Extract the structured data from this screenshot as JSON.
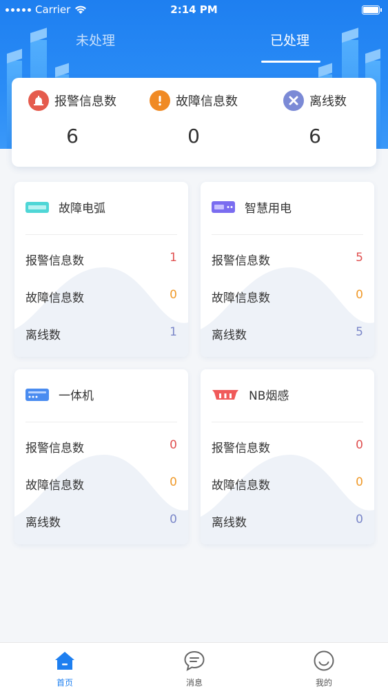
{
  "status_bar": {
    "carrier": "Carrier",
    "time": "2:14 PM"
  },
  "tabs": [
    {
      "label": "未处理",
      "active": false
    },
    {
      "label": "已处理",
      "active": true
    }
  ],
  "summary": {
    "alarm": {
      "label": "报警信息数",
      "value": "6",
      "icon": "alarm-bell-icon",
      "color": "#e55b4d"
    },
    "fault": {
      "label": "故障信息数",
      "value": "0",
      "icon": "exclamation-icon",
      "color": "#f08a24"
    },
    "offline": {
      "label": "离线数",
      "value": "6",
      "icon": "close-x-icon",
      "color": "#7b8ad6"
    }
  },
  "devices": [
    {
      "name": "故障电弧",
      "icon": "arc-fault-device-icon",
      "alarm_label": "报警信息数",
      "alarm": "1",
      "fault_label": "故障信息数",
      "fault": "0",
      "offline_label": "离线数",
      "offline": "1"
    },
    {
      "name": "智慧用电",
      "icon": "smart-power-device-icon",
      "alarm_label": "报警信息数",
      "alarm": "5",
      "fault_label": "故障信息数",
      "fault": "0",
      "offline_label": "离线数",
      "offline": "5"
    },
    {
      "name": "一体机",
      "icon": "integrated-machine-icon",
      "alarm_label": "报警信息数",
      "alarm": "0",
      "fault_label": "故障信息数",
      "fault": "0",
      "offline_label": "离线数",
      "offline": "0"
    },
    {
      "name": "NB烟感",
      "icon": "nb-smoke-detector-icon",
      "alarm_label": "报警信息数",
      "alarm": "0",
      "fault_label": "故障信息数",
      "fault": "0",
      "offline_label": "离线数",
      "offline": "0"
    }
  ],
  "bottom_nav": [
    {
      "label": "首页",
      "icon": "home-icon",
      "active": true
    },
    {
      "label": "消息",
      "icon": "message-icon",
      "active": false
    },
    {
      "label": "我的",
      "icon": "profile-smile-icon",
      "active": false
    }
  ],
  "colors": {
    "primary": "#1e7ff0",
    "alarm": "#e05050",
    "fault": "#f09a2a",
    "offline": "#7a86c8"
  }
}
